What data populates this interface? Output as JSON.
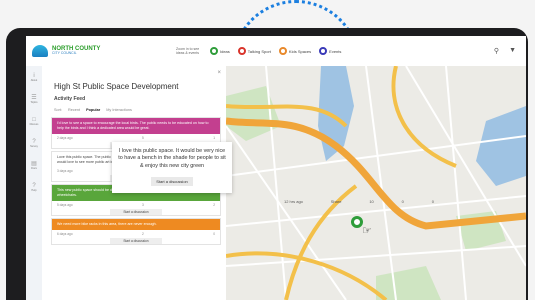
{
  "app": {
    "logo_title": "NORTH COUNTY",
    "logo_subtitle": "CITY COUNCIL",
    "zoom_hint": "Zoom in to see ideas & events"
  },
  "filters": [
    {
      "label": "Ideas",
      "color": "#2e9d3a"
    },
    {
      "label": "Talking Sport",
      "color": "#d9342b"
    },
    {
      "label": "Kids Spaces",
      "color": "#e8892b"
    },
    {
      "label": "Events",
      "color": "#3a3ab8"
    }
  ],
  "toolbar": {
    "search_icon": "search-icon",
    "filter_icon": "filter-icon"
  },
  "rail": [
    {
      "icon": "info-icon",
      "label": "About"
    },
    {
      "icon": "list-icon",
      "label": "Topics"
    },
    {
      "icon": "chat-icon",
      "label": "Discuss"
    },
    {
      "icon": "question-icon",
      "label": "Survey"
    },
    {
      "icon": "doc-icon",
      "label": "Docs"
    },
    {
      "icon": "help-icon",
      "label": "Help"
    }
  ],
  "panel": {
    "title": "High St Public Space Development",
    "subtitle": "Activity Feed",
    "tabs": [
      "Sort:",
      "Recent",
      "Popular",
      "My Interactions"
    ],
    "active_tab": "Popular",
    "close": "×"
  },
  "cards": [
    {
      "color": "#c33f8f",
      "text": "I'd love to see a space to encourage the local birds. The public needs to be educated on how to help the birds and I think a dedicated area would be great.",
      "meta_left": "2 days ago",
      "meta_mid": "5",
      "meta_right": "1",
      "button": "Start a discussion",
      "white": false
    },
    {
      "color": "#ffffff",
      "text": "Love this public space. The public need to be educated on art & we need to encourage art. We would love to see more public art in this space for everyone to enjoy.",
      "meta_left": "3 days ago",
      "meta_mid": "4",
      "meta_right": "0",
      "button": "Start a discussion",
      "white": true
    },
    {
      "color": "#59a63b",
      "text": "This new public space should be designed to welcome people with dogs & people with prams and wheelchairs.",
      "meta_left": "5 days ago",
      "meta_mid": "3",
      "meta_right": "2",
      "button": "Start a discussion",
      "white": false
    },
    {
      "color": "#ee8a21",
      "text": "We need more bike racks in this area, there are never enough.",
      "meta_left": "6 days ago",
      "meta_mid": "2",
      "meta_right": "0",
      "button": "Start a discussion",
      "white": false
    }
  ],
  "popup": {
    "text": "I love this public space. It would be very nice to have a bench in the shade for people to sit & enjoy this new city green",
    "button": "Start a discussion",
    "time": "12 hrs ago",
    "share": "Share",
    "likes": "10",
    "comments": "0",
    "replies": "0"
  }
}
